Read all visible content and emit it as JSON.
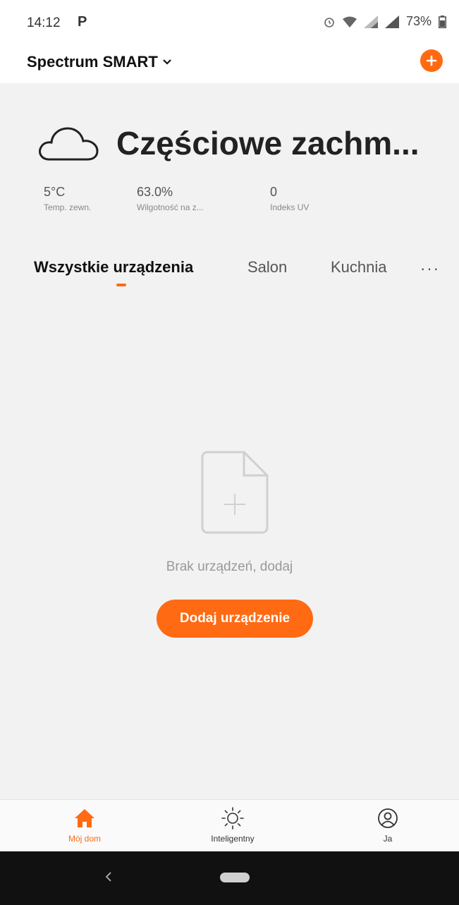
{
  "status_bar": {
    "time": "14:12",
    "app_indicator": "P",
    "battery": "73%",
    "icons": [
      "alarm-icon",
      "wifi-icon",
      "signal-icon",
      "signal-icon",
      "battery-icon"
    ]
  },
  "header": {
    "home_name": "Spectrum SMART",
    "add_icon": "plus-circle-icon"
  },
  "weather": {
    "condition": "Częściowe zachm...",
    "icon": "cloud-icon",
    "stats": [
      {
        "value": "5°C",
        "label": "Temp. zewn."
      },
      {
        "value": "63.0%",
        "label": "Wilgotność na z..."
      },
      {
        "value": "0",
        "label": "Indeks UV"
      }
    ]
  },
  "tabs": {
    "items": [
      {
        "label": "Wszystkie urządzenia",
        "active": true
      },
      {
        "label": "Salon",
        "active": false
      },
      {
        "label": "Kuchnia",
        "active": false
      }
    ],
    "more": "···"
  },
  "empty_state": {
    "icon": "file-add-icon",
    "message": "Brak urządzeń, dodaj",
    "button_label": "Dodaj urządzenie"
  },
  "bottom_nav": {
    "items": [
      {
        "label": "Mój dom",
        "icon": "home-icon",
        "active": true
      },
      {
        "label": "Inteligentny",
        "icon": "sun-icon",
        "active": false
      },
      {
        "label": "Ja",
        "icon": "user-icon",
        "active": false
      }
    ]
  },
  "colors": {
    "accent": "#ff6a13",
    "background": "#f2f2f2"
  }
}
